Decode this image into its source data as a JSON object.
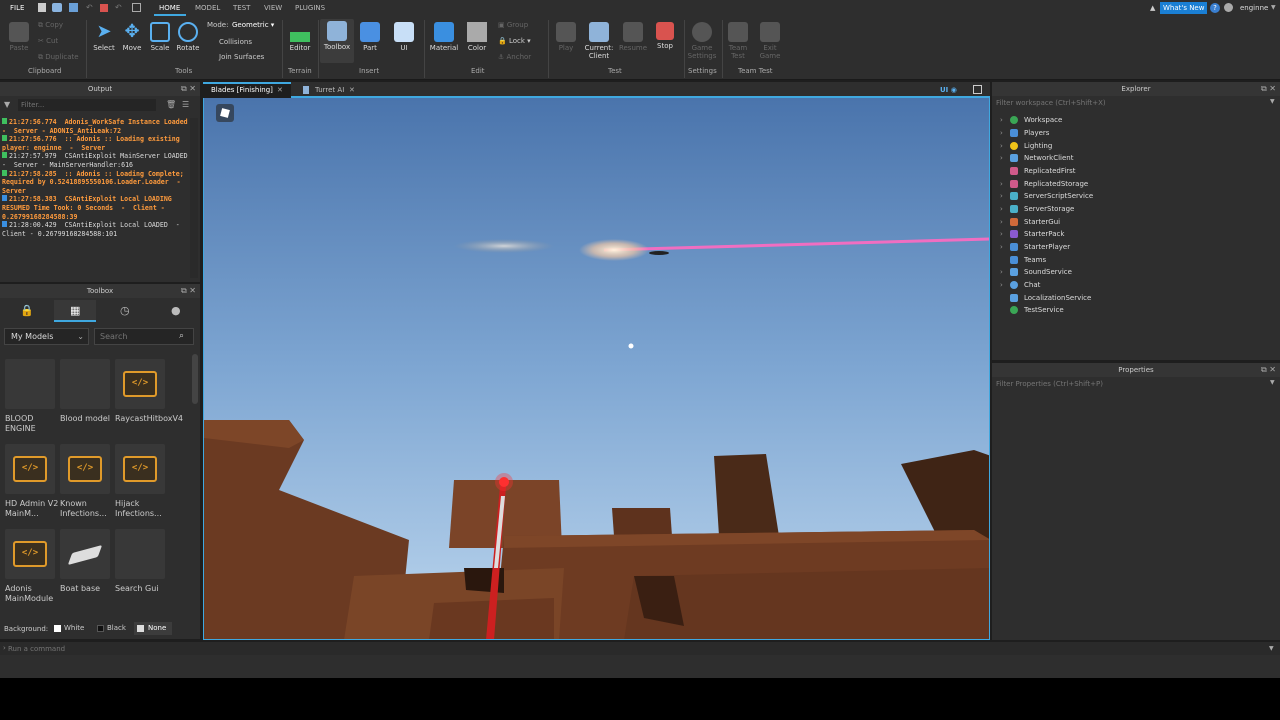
{
  "menubar": {
    "file": "FILE",
    "tabs": [
      "HOME",
      "MODEL",
      "TEST",
      "VIEW",
      "PLUGINS"
    ],
    "whats_new": "What's New",
    "user": "enginne"
  },
  "ribbon": {
    "paste": "Paste",
    "copy": "Copy",
    "cut": "Cut",
    "duplicate": "Duplicate",
    "clipboard_group": "Clipboard",
    "select": "Select",
    "move": "Move",
    "scale": "Scale",
    "rotate": "Rotate",
    "mode_label": "Mode:",
    "mode_value": "Geometric",
    "collisions": "Collisions",
    "join_surfaces": "Join Surfaces",
    "tools_group": "Tools",
    "editor": "Editor",
    "terrain_group": "Terrain",
    "toolbox": "Toolbox",
    "part": "Part",
    "ui": "UI",
    "insert_group": "Insert",
    "material": "Material",
    "color": "Color",
    "group": "Group",
    "lock": "Lock",
    "anchor": "Anchor",
    "edit_group": "Edit",
    "play": "Play",
    "current_client_1": "Current:",
    "current_client_2": "Client",
    "resume": "Resume",
    "stop": "Stop",
    "test_group": "Test",
    "game_settings_1": "Game",
    "game_settings_2": "Settings",
    "settings_group": "Settings",
    "team_test_1": "Team",
    "team_test_2": "Test",
    "exit_game_1": "Exit",
    "exit_game_2": "Game",
    "team_test_group": "Team Test"
  },
  "output": {
    "title": "Output",
    "filter_placeholder": "Filter...",
    "lines": [
      {
        "type": "green",
        "text": "21:27:56.774  Adonis_WorkSafe Instance Loaded  -  Server - ADONIS_AntiLeak:72"
      },
      {
        "type": "green",
        "text": "21:27:56.776  :: Adonis :: Loading existing player: enginne  -  Server"
      },
      {
        "type": "green",
        "text": "21:27:57.979  CSAntiExploit MainServer LOADED  -  Server - MainServerHandler:616"
      },
      {
        "type": "green",
        "text": "21:27:58.285  :: Adonis :: Loading Complete; Required by 0.52418895550106.Loader.Loader  -  Server"
      },
      {
        "type": "blue",
        "text": "21:27:58.383  CSAntiExploit Local LOADING RESUMED Time Took: 0 Seconds  -  Client - 0.26799168284588:39"
      },
      {
        "type": "blue",
        "text": "21:28:00.429  CSAntiExploit Local LOADED  -  Client - 0.26799168284588:101"
      }
    ]
  },
  "toolbox": {
    "title": "Toolbox",
    "category": "My Models",
    "search_placeholder": "Search",
    "items": [
      {
        "label": "BLOOD ENGINE",
        "icon": "blank"
      },
      {
        "label": "Blood model",
        "icon": "blank"
      },
      {
        "label": "RaycastHitboxV4",
        "icon": "script-icon"
      },
      {
        "label": "HD Admin V2 MainM...",
        "icon": "script-icon"
      },
      {
        "label": "Known Infections...",
        "icon": "script-icon"
      },
      {
        "label": "Hijack Infections...",
        "icon": "script-icon"
      },
      {
        "label": "Adonis MainModule",
        "icon": "script-icon"
      },
      {
        "label": "Boat base",
        "icon": "boat-icon"
      },
      {
        "label": "Search Gui",
        "icon": "blank"
      }
    ],
    "background_label": "Background:",
    "bg_white": "White",
    "bg_black": "Black",
    "bg_none": "None"
  },
  "viewport": {
    "tabs": [
      {
        "label": "Blades [Finishing]",
        "active": true
      },
      {
        "label": "Turret AI",
        "active": false
      }
    ],
    "ui_toggle": "UI"
  },
  "explorer": {
    "title": "Explorer",
    "filter_placeholder": "Filter workspace (Ctrl+Shift+X)",
    "items": [
      {
        "label": "Workspace",
        "color": "#3aa655"
      },
      {
        "label": "Players",
        "color": "#4a8fd8"
      },
      {
        "label": "Lighting",
        "color": "#f0c419"
      },
      {
        "label": "NetworkClient",
        "color": "#5aa0e0"
      },
      {
        "label": "ReplicatedFirst",
        "color": "#d05a8a"
      },
      {
        "label": "ReplicatedStorage",
        "color": "#d05a8a"
      },
      {
        "label": "ServerScriptService",
        "color": "#4ab0c8"
      },
      {
        "label": "ServerStorage",
        "color": "#4ab0c8"
      },
      {
        "label": "StarterGui",
        "color": "#d06a3a"
      },
      {
        "label": "StarterPack",
        "color": "#8a5ad0"
      },
      {
        "label": "StarterPlayer",
        "color": "#4a8fd8"
      },
      {
        "label": "Teams",
        "color": "#4a8fd8"
      },
      {
        "label": "SoundService",
        "color": "#5aa0e0"
      },
      {
        "label": "Chat",
        "color": "#5aa0e0"
      },
      {
        "label": "LocalizationService",
        "color": "#5aa0e0"
      },
      {
        "label": "TestService",
        "color": "#3aa655"
      }
    ]
  },
  "properties": {
    "title": "Properties",
    "filter_placeholder": "Filter Properties (Ctrl+Shift+P)"
  },
  "command_bar": {
    "placeholder": "Run a command"
  }
}
